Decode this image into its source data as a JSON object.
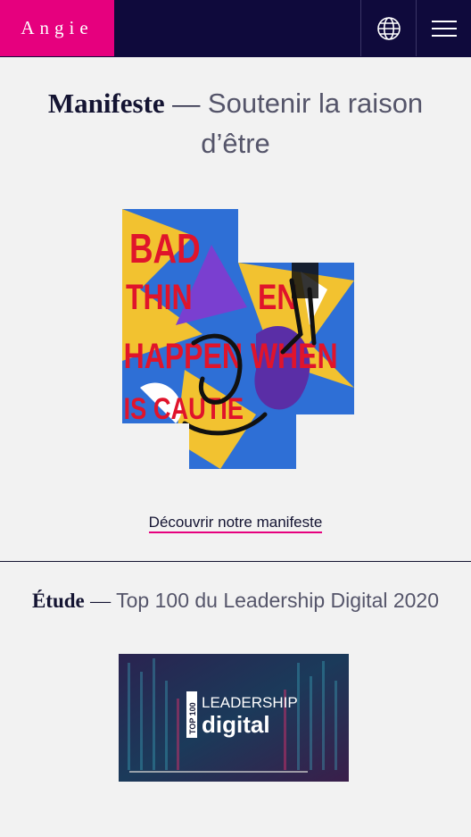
{
  "header": {
    "logo": "Angie",
    "brand_color": "#e6007e",
    "bar_color": "#0f0a3c",
    "language_icon": "globe-icon",
    "menu_icon": "hamburger-icon"
  },
  "manifesto": {
    "title_strong": "Manifeste",
    "title_dash": "—",
    "title_rest": "Soutenir la raison d’être",
    "link_label": "Découvrir notre manifeste",
    "artwork_text": "BAD THINGS HAPPEN WHEN"
  },
  "study": {
    "title_strong": "Étude",
    "title_dash": "—",
    "title_rest": "Top 100 du Leadership Digital 2020",
    "thumb_badge": "TOP 100",
    "thumb_word1": "LEADERSHIP",
    "thumb_word2": "digital"
  }
}
